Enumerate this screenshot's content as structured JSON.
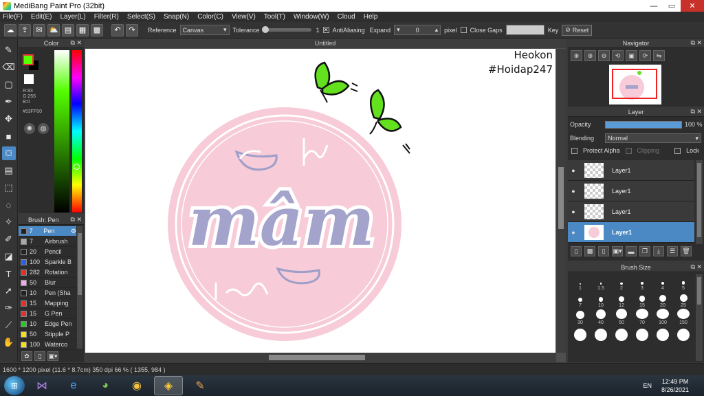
{
  "window": {
    "title": "MediBang Paint Pro (32bit)",
    "controls": {
      "minimize": "—",
      "maximize": "▭",
      "close": "✕"
    }
  },
  "menu": [
    "File(F)",
    "Edit(E)",
    "Layer(L)",
    "Filter(R)",
    "Select(S)",
    "Snap(N)",
    "Color(C)",
    "View(V)",
    "Tool(T)",
    "Window(W)",
    "Cloud",
    "Help"
  ],
  "toolbar": {
    "reference_label": "Reference",
    "reference_value": "Canvas",
    "tolerance_label": "Tolerance",
    "tolerance_value": "1",
    "antialiasing_label": "AntiAliasing",
    "expand_label": "Expand",
    "expand_value": "0",
    "expand_unit": "pixel",
    "close_gaps_label": "Close Gaps",
    "key_label": "Key",
    "reset_label": "Reset"
  },
  "color_panel": {
    "title": "Color",
    "r": "R:83",
    "g": "G:255",
    "b": "B:0",
    "hex": "#53FF00",
    "foreground": "#53ff00"
  },
  "brush_panel": {
    "title": "Brush: Pen",
    "brushes": [
      {
        "size": "7",
        "name": "Pen",
        "color": "#222222"
      },
      {
        "size": "7",
        "name": "Airbrush",
        "color": "#aaaaaa"
      },
      {
        "size": "20",
        "name": "Pencil",
        "color": "#222222"
      },
      {
        "size": "100",
        "name": "Sparkle B",
        "color": "#2f5fe0"
      },
      {
        "size": "282",
        "name": "Rotation",
        "color": "#e03030"
      },
      {
        "size": "50",
        "name": "Blur",
        "color": "#f3a8e8"
      },
      {
        "size": "10",
        "name": "Pen (Sha",
        "color": "#222222"
      },
      {
        "size": "15",
        "name": "Mapping",
        "color": "#e03030"
      },
      {
        "size": "15",
        "name": "G Pen",
        "color": "#e03030"
      },
      {
        "size": "10",
        "name": "Edge Pen",
        "color": "#22cc22"
      },
      {
        "size": "50",
        "name": "Stipple P",
        "color": "#f5e020"
      },
      {
        "size": "100",
        "name": "Waterco",
        "color": "#f5e020"
      }
    ]
  },
  "canvas": {
    "tab": "Untitled",
    "watermark_line1": "Heokon",
    "watermark_line2": "#Hoidap247",
    "art_text": "mâm"
  },
  "status": "1600 * 1200 pixel   (11.6 * 8.7cm)   350 dpi   66 %   ( 1355, 984 )",
  "navigator": {
    "title": "Navigator"
  },
  "layer_panel": {
    "title": "Layer",
    "opacity_label": "Opacity",
    "opacity_value": "100 %",
    "opacity": 1.0,
    "blending_label": "Blending",
    "blending_value": "Normal",
    "protect_alpha": "Protect Alpha",
    "clipping": "Clipping",
    "lock": "Lock",
    "layers": [
      "Layer1",
      "Layer1",
      "Layer1",
      "Layer1"
    ]
  },
  "brush_size_panel": {
    "title": "Brush Size",
    "sizes": [
      "1",
      "1.5",
      "2",
      "3",
      "4",
      "5",
      "7",
      "10",
      "12",
      "15",
      "20",
      "25",
      "30",
      "40",
      "50",
      "70",
      "100",
      "150"
    ]
  },
  "taskbar": {
    "lang": "EN",
    "time": "12:49 PM",
    "date": "8/26/2021"
  }
}
